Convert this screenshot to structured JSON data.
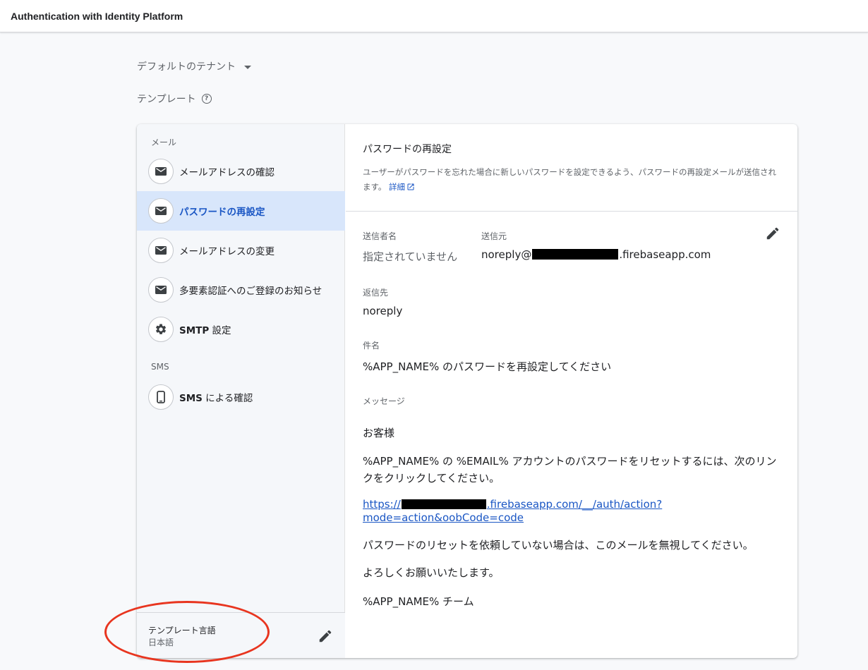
{
  "app": {
    "title": "Authentication with Identity Platform"
  },
  "tenant": {
    "label": "デフォルトのテナント"
  },
  "templates": {
    "heading": "テンプレート"
  },
  "sidebar": {
    "email_section": "メール",
    "sms_section": "SMS",
    "items": [
      {
        "label": "メールアドレスの確認",
        "icon": "mail-icon"
      },
      {
        "label": "パスワードの再設定",
        "icon": "mail-icon",
        "active": true
      },
      {
        "label": "メールアドレスの変更",
        "icon": "mail-icon"
      },
      {
        "label": "多要素認証へのご登録のお知らせ",
        "icon": "mail-icon"
      },
      {
        "label_bold": "SMTP",
        "label_rest": " 設定",
        "icon": "gear-icon"
      },
      {
        "label_bold": "SMS",
        "label_rest": " による確認",
        "icon": "phone-icon"
      }
    ],
    "footer": {
      "label": "テンプレート言語",
      "value": "日本語"
    }
  },
  "main": {
    "title": "パスワードの再設定",
    "description": "ユーザーがパスワードを忘れた場合に新しいパスワードを設定できるよう、パスワードの再設定メールが送信されます。",
    "detail_link": "詳細",
    "sender_name_label": "送信者名",
    "sender_name_value": "指定されていません",
    "from_label": "送信元",
    "from_prefix": "noreply@",
    "from_suffix": ".firebaseapp.com",
    "reply_to_label": "返信先",
    "reply_to_value": "noreply",
    "subject_label": "件名",
    "subject_value": "%APP_NAME% のパスワードを再設定してください",
    "message_label": "メッセージ",
    "message": {
      "greeting": "お客様",
      "line1": "%APP_NAME% の %EMAIL% アカウントのパスワードをリセットするには、次のリンクをクリックしてください。",
      "link_prefix": "https://",
      "link_suffix": ".firebaseapp.com/__/auth/action?",
      "link_line2": "mode=action&oobCode=code",
      "line2": "パスワードのリセットを依頼していない場合は、このメールを無視してください。",
      "line3": "よろしくお願いいたします。",
      "signature": "%APP_NAME% チーム"
    }
  },
  "colors": {
    "accent": "#1a56c4",
    "active_bg": "#d8e6fb",
    "annotation": "#e8351f"
  }
}
